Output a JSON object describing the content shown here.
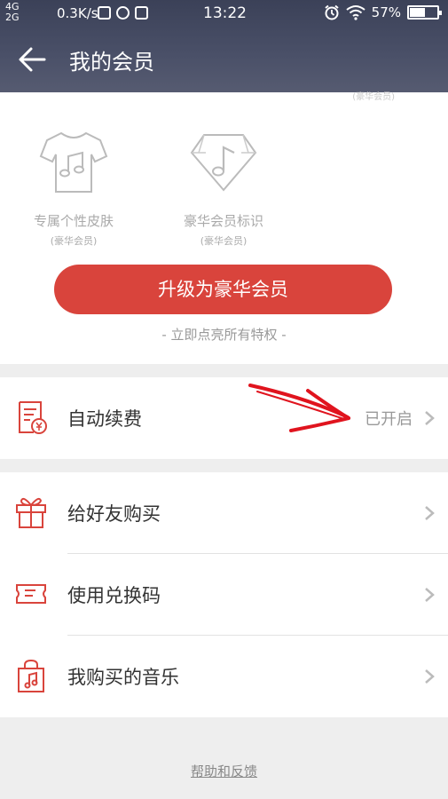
{
  "status_bar": {
    "network_top": "4G",
    "network_bottom": "2G",
    "speed": "0.3K/s",
    "time": "13:22",
    "battery_percent": "57%",
    "battery_level": 0.57
  },
  "header": {
    "title": "我的会员",
    "back_icon": "arrow-left-icon"
  },
  "privileges": {
    "peek_text": "(豪华会员)",
    "items": [
      {
        "name": "专属个性皮肤",
        "sub": "(豪华会员)",
        "icon": "tshirt-music-icon"
      },
      {
        "name": "豪华会员标识",
        "sub": "(豪华会员)",
        "icon": "diamond-music-icon"
      }
    ],
    "upgrade_label": "升级为豪华会员",
    "hint": "- 立即点亮所有特权 -"
  },
  "auto_renew": {
    "label": "自动续费",
    "value": "已开启",
    "icon": "bill-yen-icon"
  },
  "menu": [
    {
      "label": "给好友购买",
      "icon": "gift-icon"
    },
    {
      "label": "使用兑换码",
      "icon": "ticket-icon"
    },
    {
      "label": "我购买的音乐",
      "icon": "shopping-bag-music-icon"
    }
  ],
  "footer": {
    "help_label": "帮助和反馈"
  },
  "colors": {
    "accent": "#d9443c",
    "header_bg": "#4a5068",
    "page_bg": "#eeeeee",
    "annotation": "#e0141e"
  }
}
